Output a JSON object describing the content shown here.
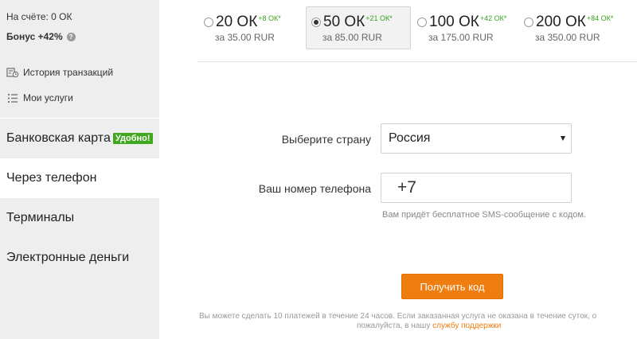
{
  "account": {
    "balance": "На счёте: 0 ОК",
    "bonus": "Бонус +42%",
    "help_icon": "?"
  },
  "sidebar": {
    "links": [
      {
        "label": "История транзакций",
        "icon": "history-icon"
      },
      {
        "label": "Мои услуги",
        "icon": "list-icon"
      }
    ],
    "menu": [
      {
        "label": "Банковская карта",
        "badge": "Удобно!"
      },
      {
        "label": "Через телефон",
        "active": true
      },
      {
        "label": "Терминалы"
      },
      {
        "label": "Электронные деньги"
      }
    ]
  },
  "packages": [
    {
      "amount": "20 ОК",
      "extra": "+8 ОК*",
      "price": "за 35.00 RUR",
      "selected": false
    },
    {
      "amount": "50 ОК",
      "extra": "+21 ОК*",
      "price": "за 85.00 RUR",
      "selected": true
    },
    {
      "amount": "100 ОК",
      "extra": "+42 ОК*",
      "price": "за 175.00 RUR",
      "selected": false
    },
    {
      "amount": "200 ОК",
      "extra": "+84 ОК*",
      "price": "за 350.00 RUR",
      "selected": false
    }
  ],
  "form": {
    "country_label": "Выберите страну",
    "country_value": "Россия",
    "phone_label": "Ваш номер телефона",
    "phone_value": "+7",
    "hint": "Вам придёт бесплатное SMS-сообщение с кодом.",
    "submit": "Получить код"
  },
  "footnote": {
    "line1": "Вы можете сделать 10 платежей в течение 24 часов. Если заказанная услуга не оказана в течение суток, о",
    "line2_prefix": "пожалуйста, в нашу ",
    "support_link": "службу поддержки"
  },
  "colors": {
    "accent": "#ef7d0f",
    "bonus_green": "#3aa21d",
    "badge_green": "#3fa81f",
    "sidebar_bg": "#eeeeee"
  }
}
